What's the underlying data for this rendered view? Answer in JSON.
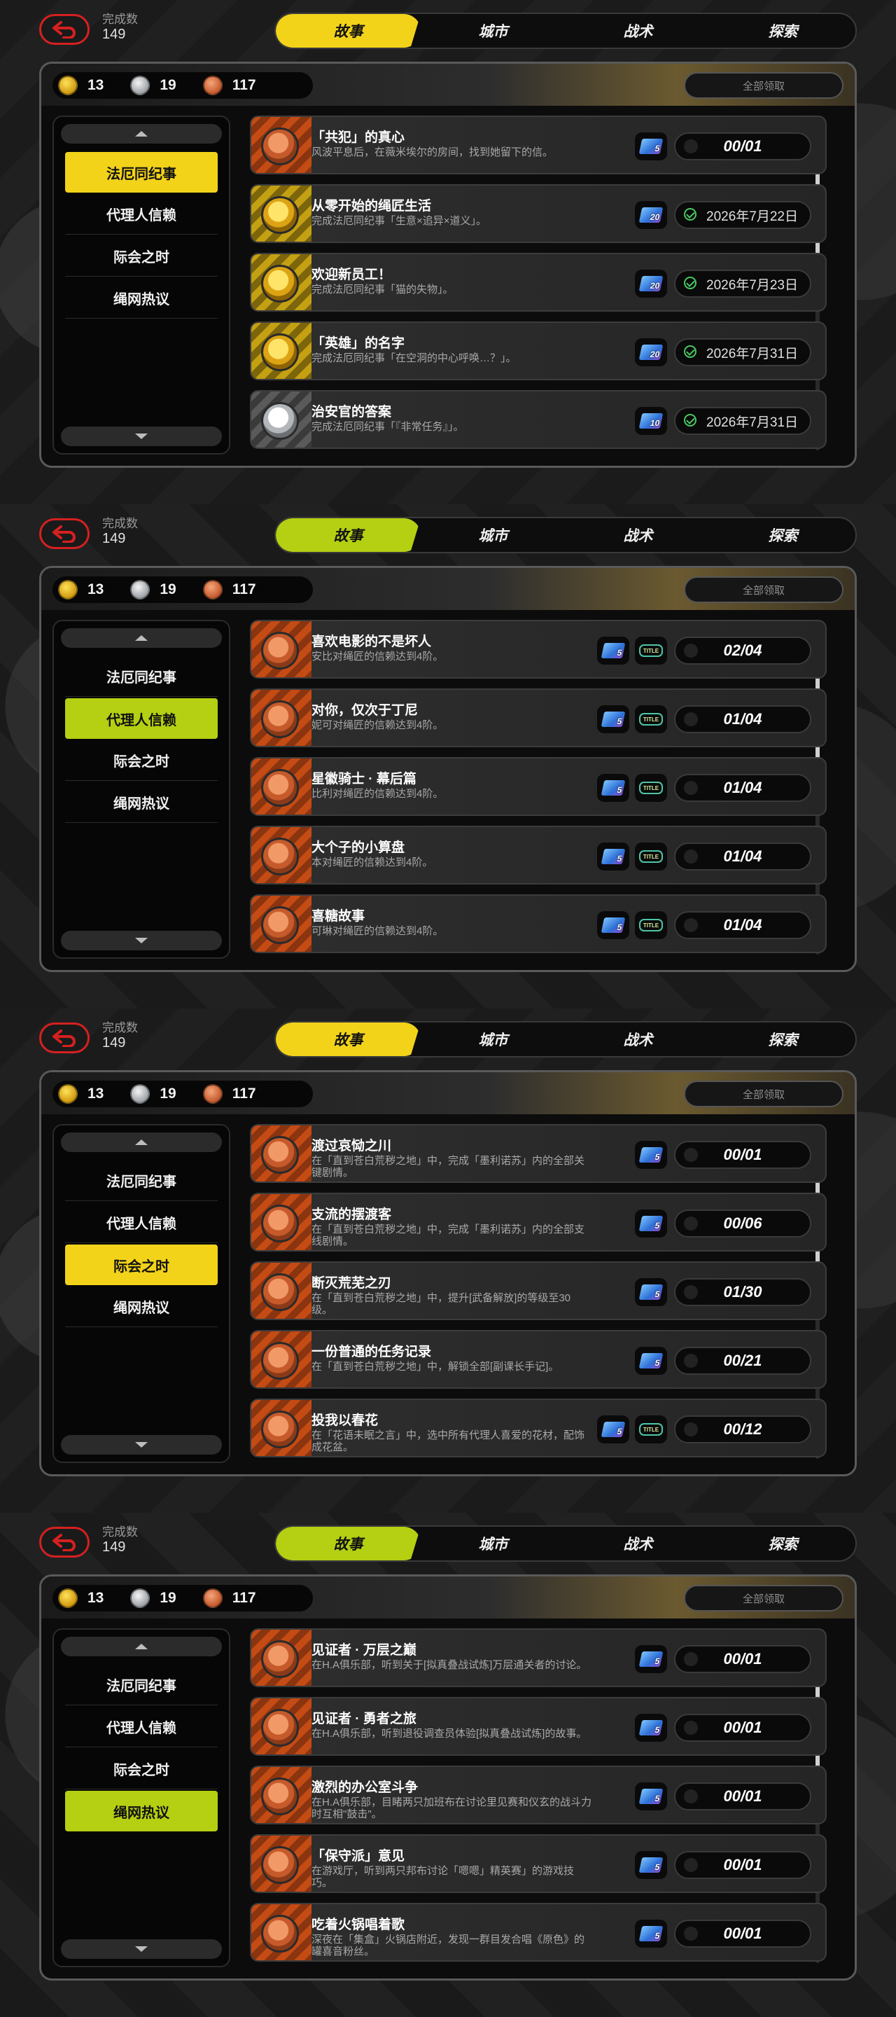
{
  "colors": {
    "accent_yellow": "#f2d31a",
    "accent_lime": "#b5cf12",
    "back_red": "#d62020",
    "check_green": "#46c860"
  },
  "common": {
    "count_label": "完成数",
    "count_value": "149",
    "tabs": [
      "故事",
      "城市",
      "战术",
      "探索"
    ],
    "currency": {
      "gold": "13",
      "silver": "19",
      "bronze": "117"
    },
    "claim_all": "全部领取",
    "categories": [
      "法厄同纪事",
      "代理人信赖",
      "际会之时",
      "绳网热议"
    ]
  },
  "screens": [
    {
      "active_tab": 0,
      "active_category": 0,
      "accent": "#f2d31a",
      "quests": [
        {
          "title": "「共犯」的真心",
          "desc": "风波平息后，在薇米埃尔的房间，找到她留下的信。",
          "medal": "bronze",
          "reward_num": "5",
          "title_reward": false,
          "status": "00/01",
          "claimed": false
        },
        {
          "title": "从零开始的绳匠生活",
          "desc": "完成法厄同纪事「生意×追异×道义」。",
          "medal": "gold",
          "reward_num": "20",
          "title_reward": false,
          "status": "2026年7月22日",
          "claimed": true
        },
        {
          "title": "欢迎新员工！",
          "desc": "完成法厄同纪事「猫的失物」。",
          "medal": "gold",
          "reward_num": "20",
          "title_reward": false,
          "status": "2026年7月23日",
          "claimed": true
        },
        {
          "title": "「英雄」的名字",
          "desc": "完成法厄同纪事「在空洞的中心呼唤…？」。",
          "medal": "gold",
          "reward_num": "20",
          "title_reward": false,
          "status": "2026年7月31日",
          "claimed": true
        },
        {
          "title": "治安官的答案",
          "desc": "完成法厄同纪事「『非常任务』」。",
          "medal": "silver",
          "reward_num": "10",
          "title_reward": false,
          "status": "2026年7月31日",
          "claimed": true
        }
      ]
    },
    {
      "active_tab": 0,
      "active_category": 1,
      "accent": "#b5cf12",
      "quests": [
        {
          "title": "喜欢电影的不是坏人",
          "desc": "安比对绳匠的信赖达到4阶。",
          "medal": "bronze",
          "reward_num": "5",
          "title_reward": true,
          "status": "02/04",
          "claimed": false
        },
        {
          "title": "对你，仅次于丁尼",
          "desc": "妮可对绳匠的信赖达到4阶。",
          "medal": "bronze",
          "reward_num": "5",
          "title_reward": true,
          "status": "01/04",
          "claimed": false
        },
        {
          "title": "星徽骑士 · 幕后篇",
          "desc": "比利对绳匠的信赖达到4阶。",
          "medal": "bronze",
          "reward_num": "5",
          "title_reward": true,
          "status": "01/04",
          "claimed": false
        },
        {
          "title": "大个子的小算盘",
          "desc": "本对绳匠的信赖达到4阶。",
          "medal": "bronze",
          "reward_num": "5",
          "title_reward": true,
          "status": "01/04",
          "claimed": false
        },
        {
          "title": "喜糖故事",
          "desc": "可琳对绳匠的信赖达到4阶。",
          "medal": "bronze",
          "reward_num": "5",
          "title_reward": true,
          "status": "01/04",
          "claimed": false
        }
      ]
    },
    {
      "active_tab": 0,
      "active_category": 2,
      "accent": "#f2d31a",
      "quests": [
        {
          "title": "渡过哀恸之川",
          "desc": "在「直到苍白荒秽之地」中，完成「墨利诺苏」内的全部关键剧情。",
          "medal": "bronze",
          "reward_num": "5",
          "title_reward": false,
          "status": "00/01",
          "claimed": false
        },
        {
          "title": "支流的摆渡客",
          "desc": "在「直到苍白荒秽之地」中，完成「墨利诺苏」内的全部支线剧情。",
          "medal": "bronze",
          "reward_num": "5",
          "title_reward": false,
          "status": "00/06",
          "claimed": false
        },
        {
          "title": "断灭荒芜之刃",
          "desc": "在「直到苍白荒秽之地」中，提升[武备解放]的等级至30级。",
          "medal": "bronze",
          "reward_num": "5",
          "title_reward": false,
          "status": "01/30",
          "claimed": false
        },
        {
          "title": "一份普通的任务记录",
          "desc": "在「直到苍白荒秽之地」中，解锁全部[副课长手记]。",
          "medal": "bronze",
          "reward_num": "5",
          "title_reward": false,
          "status": "00/21",
          "claimed": false
        },
        {
          "title": "投我以春花",
          "desc": "在「花语未眠之言」中，选中所有代理人喜爱的花材，配饰成花盆。",
          "medal": "bronze",
          "reward_num": "5",
          "title_reward": true,
          "status": "00/12",
          "claimed": false
        }
      ]
    },
    {
      "active_tab": 0,
      "active_category": 3,
      "accent": "#b5cf12",
      "quests": [
        {
          "title": "见证者 · 万层之巅",
          "desc": "在H.A俱乐部，听到关于[拟真叠战试炼]万层通关者的讨论。",
          "medal": "bronze",
          "reward_num": "5",
          "title_reward": false,
          "status": "00/01",
          "claimed": false
        },
        {
          "title": "见证者 · 勇者之旅",
          "desc": "在H.A俱乐部，听到退役调查员体验[拟真叠战试炼]的故事。",
          "medal": "bronze",
          "reward_num": "5",
          "title_reward": false,
          "status": "00/01",
          "claimed": false
        },
        {
          "title": "激烈的办公室斗争",
          "desc": "在H.A俱乐部，目睹两只加班布在讨论里见赛和仪玄的战斗力时互相\"鼓击\"。",
          "medal": "bronze",
          "reward_num": "5",
          "title_reward": false,
          "status": "00/01",
          "claimed": false
        },
        {
          "title": "「保守派」意见",
          "desc": "在游戏厅，听到两只邦布讨论「嗯嗯」精英赛」的游戏技巧。",
          "medal": "bronze",
          "reward_num": "5",
          "title_reward": false,
          "status": "00/01",
          "claimed": false
        },
        {
          "title": "吃着火锅唱着歌",
          "desc": "深夜在「集盒」火锅店附近，发现一群目发合唱《原色》的罐喜音粉丝。",
          "medal": "bronze",
          "reward_num": "5",
          "title_reward": false,
          "status": "00/01",
          "claimed": false
        }
      ]
    }
  ]
}
